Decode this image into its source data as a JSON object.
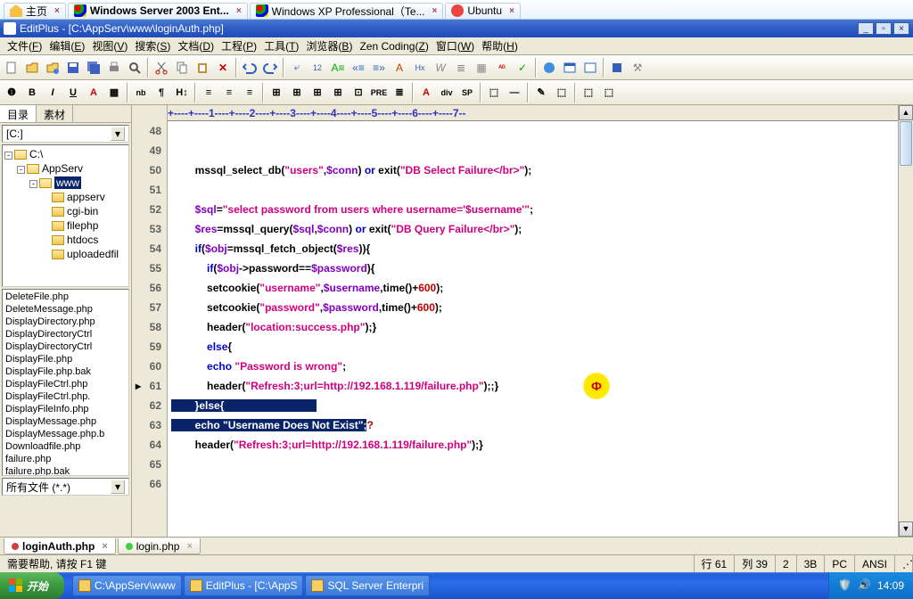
{
  "browser": {
    "tabs": [
      {
        "label": "主页",
        "icon": "home"
      },
      {
        "label": "Windows Server 2003 Ent...",
        "icon": "win",
        "active": true
      },
      {
        "label": "Windows XP Professional（Te...",
        "icon": "win"
      },
      {
        "label": "Ubuntu",
        "icon": "ubu"
      }
    ]
  },
  "title": "EditPlus - [C:\\AppServ\\www\\loginAuth.php]",
  "menus": [
    {
      "t": "文件",
      "k": "F"
    },
    {
      "t": "编辑",
      "k": "E"
    },
    {
      "t": "视图",
      "k": "V"
    },
    {
      "t": "搜索",
      "k": "S"
    },
    {
      "t": "文档",
      "k": "D"
    },
    {
      "t": "工程",
      "k": "P"
    },
    {
      "t": "工具",
      "k": "T"
    },
    {
      "t": "浏览器",
      "k": "B"
    },
    {
      "t": "Zen Coding",
      "k": "Z"
    },
    {
      "t": "窗口",
      "k": "W"
    },
    {
      "t": "帮助",
      "k": "H"
    }
  ],
  "toolbar2": [
    "❶",
    "B",
    "I",
    "U",
    "A",
    "▦",
    "|",
    "nb",
    "¶",
    "H↕",
    "|",
    "≡",
    "≡",
    "≡",
    "|",
    "⊞",
    "⊞",
    "⊞",
    "⊞",
    "⊡",
    "PRE",
    "≣",
    "|",
    "A",
    "div",
    "SP",
    "|",
    "⬚",
    "—",
    "|",
    "✎",
    "⬚",
    "|",
    "⬚",
    "⬚"
  ],
  "sidebar": {
    "tabs": [
      "目录",
      "素材"
    ],
    "drive": "[C:]",
    "filter": "所有文件 (*.*)",
    "tree": [
      {
        "d": 0,
        "exp": "-",
        "label": "C:\\",
        "open": true
      },
      {
        "d": 1,
        "exp": "-",
        "label": "AppServ",
        "open": true
      },
      {
        "d": 2,
        "exp": "-",
        "label": "www",
        "open": true,
        "sel": true
      },
      {
        "d": 3,
        "label": "appserv"
      },
      {
        "d": 3,
        "label": "cgi-bin"
      },
      {
        "d": 3,
        "label": "filephp"
      },
      {
        "d": 3,
        "label": "htdocs"
      },
      {
        "d": 3,
        "label": "uploadedfil"
      }
    ],
    "files": [
      "DeleteFile.php",
      "DeleteMessage.php",
      "DisplayDirectory.php",
      "DisplayDirectoryCtrl",
      "DisplayDirectoryCtrl",
      "DisplayFile.php",
      "DisplayFile.php.bak",
      "DisplayFileCtrl.php",
      "DisplayFileCtrl.php.",
      "DisplayFileInfo.php",
      "DisplayMessage.php",
      "DisplayMessage.php.b",
      "Downloadfile.php",
      "failure.php",
      "failure.php.bak"
    ]
  },
  "ruler": "+----+----1----+----2----+----3----+----4----+----5----+----6----+----7--",
  "code": {
    "start": 48,
    "current": 61,
    "lines_html": [
      "        <span class='fn'>mssql_select_db</span>(<span class='str'>\"users\"</span>,<span class='var'>$conn</span>) <span class='kw'>or</span> <span class='fn'>exit</span>(<span class='str'>\"DB Select Failure&lt;/br&gt;\"</span>);",
      "",
      "        <span class='var'>$sql</span>=<span class='str'>\"select password from users where username='$username'\"</span>;",
      "        <span class='var'>$res</span>=<span class='fn'>mssql_query</span>(<span class='var'>$sql</span>,<span class='var'>$conn</span>) <span class='kw'>or</span> <span class='fn'>exit</span>(<span class='str'>\"DB Query Failure&lt;/br&gt;\"</span>);",
      "        <span class='kw'>if</span>(<span class='var'>$obj</span>=<span class='fn'>mssql_fetch_object</span>(<span class='var'>$res</span>)){",
      "            <span class='kw'>if</span>(<span class='var'>$obj</span>-&gt;password==<span class='var'>$password</span>){",
      "            <span class='fn'>setcookie</span>(<span class='str'>\"username\"</span>,<span class='var'>$username</span>,<span class='fn'>time</span>()+<span class='num'>600</span>);",
      "            <span class='fn'>setcookie</span>(<span class='str'>\"password\"</span>,<span class='var'>$password</span>,<span class='fn'>time</span>()+<span class='num'>600</span>);",
      "            <span class='fn'>header</span>(<span class='str'>\"location:success.php\"</span>);}",
      "            <span class='kw'>else</span>{",
      "            <span class='kw'>echo</span> <span class='str'>\"Password is wrong\"</span>;",
      "            <span class='fn'>header</span>(<span class='str'>\"Refresh:3;url=http://192.168.1.119/failure.php\"</span>);;}",
      "<span class='sel'>        }<span class='kw'>else</span>{                               </span>",
      "<span class='sel'>        <span class='kw'>echo</span> <span class='str'>\"Username Does Not Exist\"</span>;</span><span class='op'>?</span>",
      "        <span class='fn'>header</span>(<span class='str'>\"Refresh:3;url=http://192.168.1.119/failure.php\"</span>);}",
      "",
      "",
      "",
      ""
    ]
  },
  "doctabs": [
    {
      "label": "loginAuth.php",
      "active": true,
      "color": "#d04040"
    },
    {
      "label": "login.php",
      "active": false,
      "color": "#40d040"
    }
  ],
  "status": {
    "hint": "需要帮助, 请按 F1 键",
    "row_label": "行",
    "row": "61",
    "col_label": "列",
    "col": "39",
    "c3": "2",
    "c4": "3B",
    "c5": "PC",
    "c6": "ANSI"
  },
  "taskbar": {
    "start": "开始",
    "items": [
      {
        "label": "C:\\AppServ\\www"
      },
      {
        "label": "EditPlus - [C:\\AppS"
      },
      {
        "label": "SQL Server Enterpri"
      }
    ],
    "clock": "14:09"
  }
}
